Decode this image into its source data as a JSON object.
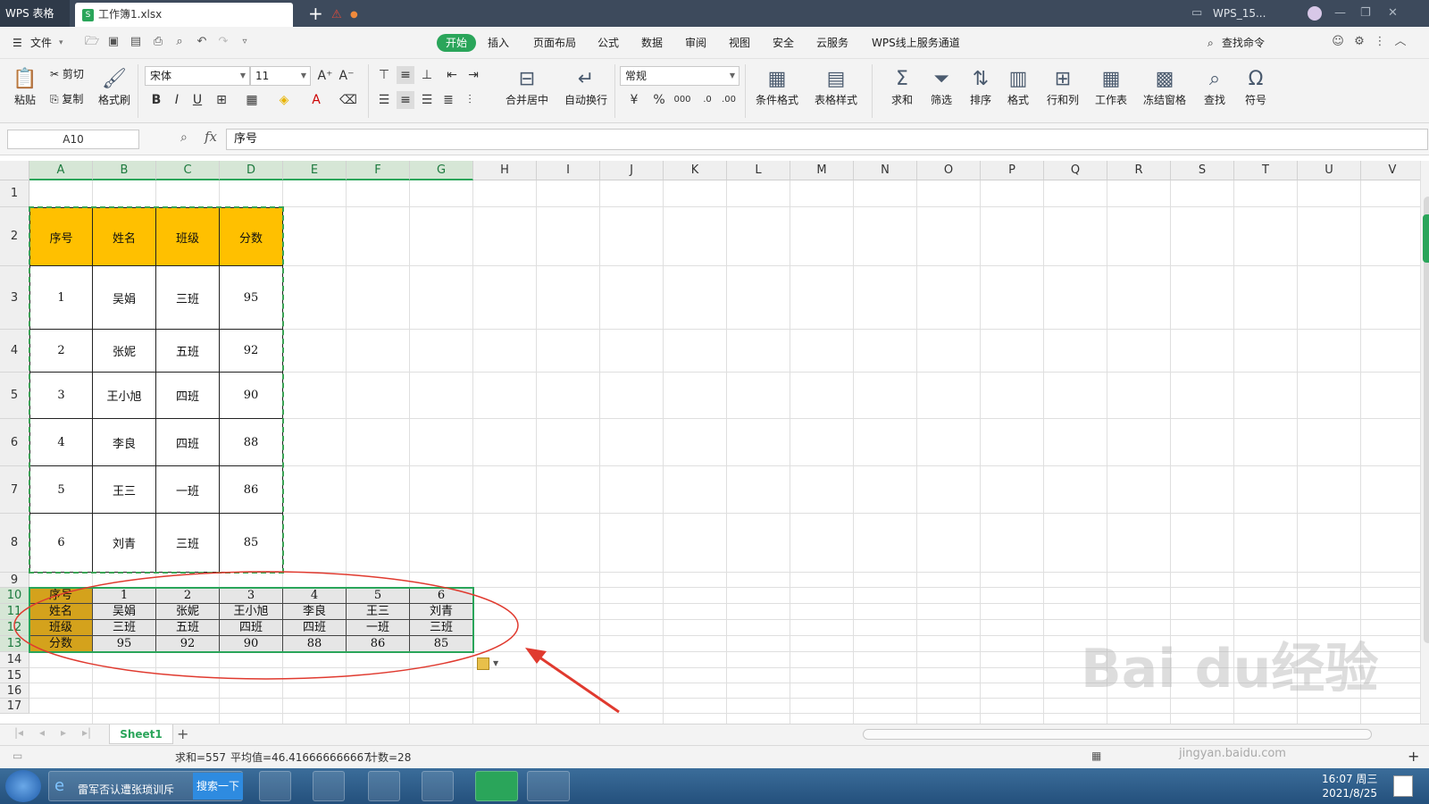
{
  "title_bar": {
    "app_name": "WPS 表格",
    "doc_tab": "工作簿1.xlsx",
    "user": "WPS_15..."
  },
  "menu": {
    "file": "文件",
    "tabs": [
      "开始",
      "插入",
      "页面布局",
      "公式",
      "数据",
      "审阅",
      "视图",
      "安全",
      "云服务",
      "WPS线上服务通道"
    ],
    "active_tab": "开始",
    "search_command": "查找命令"
  },
  "ribbon": {
    "paste": "粘贴",
    "cut": "剪切",
    "copy": "复制",
    "format_painter": "格式刷",
    "font_name": "宋体",
    "font_size": "11",
    "merge_center": "合并居中",
    "wrap_text": "自动换行",
    "number_format": "常规",
    "conditional_format": "条件格式",
    "table_style": "表格样式",
    "sum": "求和",
    "filter": "筛选",
    "sort": "排序",
    "format": "格式",
    "row_col": "行和列",
    "worksheet": "工作表",
    "freeze": "冻结窗格",
    "find": "查找",
    "symbol": "符号"
  },
  "formula_bar": {
    "name_box": "A10",
    "fx": "fx",
    "value": "序号"
  },
  "grid": {
    "columns": [
      "A",
      "B",
      "C",
      "D",
      "E",
      "F",
      "G",
      "H",
      "I",
      "J",
      "K",
      "L",
      "M",
      "N",
      "O",
      "P",
      "Q",
      "R",
      "S",
      "T",
      "U",
      "V"
    ],
    "rows": [
      "1",
      "2",
      "3",
      "4",
      "5",
      "6",
      "7",
      "8",
      "9",
      "10",
      "11",
      "12",
      "13",
      "14",
      "15",
      "16",
      "17"
    ],
    "source_table": {
      "headers": [
        "序号",
        "姓名",
        "班级",
        "分数"
      ],
      "rows": [
        [
          "1",
          "吴娟",
          "三班",
          "95"
        ],
        [
          "2",
          "张妮",
          "五班",
          "92"
        ],
        [
          "3",
          "王小旭",
          "四班",
          "90"
        ],
        [
          "4",
          "李良",
          "四班",
          "88"
        ],
        [
          "5",
          "王三",
          "一班",
          "86"
        ],
        [
          "6",
          "刘青",
          "三班",
          "85"
        ]
      ]
    },
    "transposed_table": [
      [
        "序号",
        "1",
        "2",
        "3",
        "4",
        "5",
        "6"
      ],
      [
        "姓名",
        "吴娟",
        "张妮",
        "王小旭",
        "李良",
        "王三",
        "刘青"
      ],
      [
        "班级",
        "三班",
        "五班",
        "四班",
        "四班",
        "一班",
        "三班"
      ],
      [
        "分数",
        "95",
        "92",
        "90",
        "88",
        "86",
        "85"
      ]
    ]
  },
  "sheets": {
    "active": "Sheet1"
  },
  "status": {
    "sum": "求和=557",
    "average": "平均值=46.416666666667",
    "count": "计数=28"
  },
  "taskbar": {
    "search_text": "雷军否认遭张琐训斥",
    "search_button": "搜索一下",
    "time": "16:07 周三",
    "date": "2021/8/25"
  },
  "watermark": {
    "brand": "Bai du经验",
    "url": "jingyan.baidu.com"
  },
  "colors": {
    "accent": "#2aa55a",
    "header_fill": "#ffc000",
    "annotation": "#e03a2f"
  }
}
